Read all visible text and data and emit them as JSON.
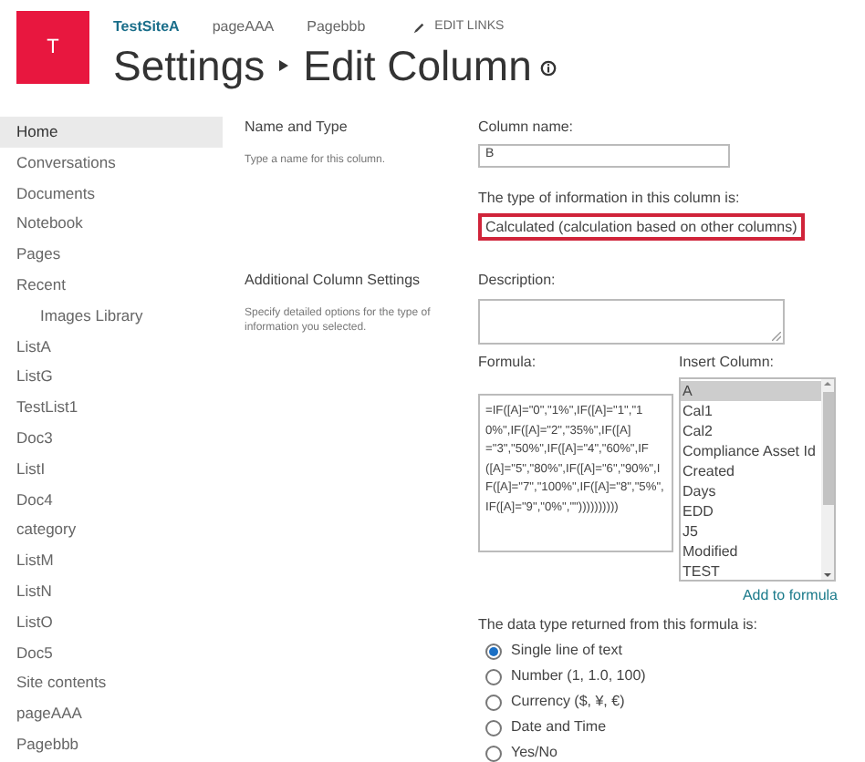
{
  "header": {
    "logo_letter": "T",
    "top_links": [
      {
        "label": "TestSiteA",
        "selected": true
      },
      {
        "label": "pageAAA",
        "selected": false
      },
      {
        "label": "Pagebbb",
        "selected": false
      }
    ],
    "edit_links": "EDIT LINKS",
    "title": [
      "Settings",
      "Edit Column"
    ]
  },
  "sidebar": {
    "items": [
      {
        "label": "Home",
        "selected": true
      },
      {
        "label": "Conversations",
        "selected": false
      },
      {
        "label": "Documents",
        "selected": false
      },
      {
        "label": "Notebook",
        "selected": false
      },
      {
        "label": "Pages",
        "selected": false
      },
      {
        "label": "Recent",
        "selected": false,
        "children": [
          {
            "label": "Images Library",
            "selected": false
          }
        ]
      },
      {
        "label": "ListA",
        "selected": false
      },
      {
        "label": "ListG",
        "selected": false
      },
      {
        "label": "TestList1",
        "selected": false
      },
      {
        "label": "Doc3",
        "selected": false
      },
      {
        "label": "ListI",
        "selected": false
      },
      {
        "label": "Doc4",
        "selected": false
      },
      {
        "label": "category",
        "selected": false
      },
      {
        "label": "ListM",
        "selected": false
      },
      {
        "label": "ListN",
        "selected": false
      },
      {
        "label": "ListO",
        "selected": false
      },
      {
        "label": "Doc5",
        "selected": false
      },
      {
        "label": "Site contents",
        "selected": false
      },
      {
        "label": "pageAAA",
        "selected": false
      },
      {
        "label": "Pagebbb",
        "selected": false
      }
    ]
  },
  "sections": [
    {
      "title": "Name and Type",
      "description": "Type a name for this column."
    },
    {
      "title": "Additional Column Settings",
      "description": "Specify detailed options for the type of information you selected."
    }
  ],
  "form": {
    "column_name_label": "Column name:",
    "column_name_value": "B",
    "type_label": "The type of information in this column is:",
    "type_value": "Calculated (calculation based on other columns)",
    "description_label": "Description:",
    "formula_label": "Formula:",
    "formula_value": "=IF([A]=\"0\",\"1%\",IF([A]=\"1\",\"10%\",IF([A]=\"2\",\"35%\",IF([A]=\"3\",\"50%\",IF([A]=\"4\",\"60%\",IF([A]=\"5\",\"80%\",IF([A]=\"6\",\"90%\",IF([A]=\"7\",\"100%\",IF([A]=\"8\",\"5%\",IF([A]=\"9\",\"0%\",\"\"))))))))))",
    "insert_column_label": "Insert Column:",
    "columns": [
      {
        "label": "A",
        "selected": true
      },
      {
        "label": "Cal1",
        "selected": false
      },
      {
        "label": "Cal2",
        "selected": false
      },
      {
        "label": "Compliance Asset Id",
        "selected": false
      },
      {
        "label": "Created",
        "selected": false
      },
      {
        "label": "Days",
        "selected": false
      },
      {
        "label": "EDD",
        "selected": false
      },
      {
        "label": "J5",
        "selected": false
      },
      {
        "label": "Modified",
        "selected": false
      },
      {
        "label": "TEST",
        "selected": false
      }
    ],
    "add_to_formula": "Add to formula",
    "return_type_label": "The data type returned from this formula is:",
    "return_types": [
      {
        "label": "Single line of text",
        "selected": true
      },
      {
        "label": "Number (1, 1.0, 100)",
        "selected": false
      },
      {
        "label": "Currency ($, ¥, €)",
        "selected": false
      },
      {
        "label": "Date and Time",
        "selected": false
      },
      {
        "label": "Yes/No",
        "selected": false
      }
    ]
  }
}
